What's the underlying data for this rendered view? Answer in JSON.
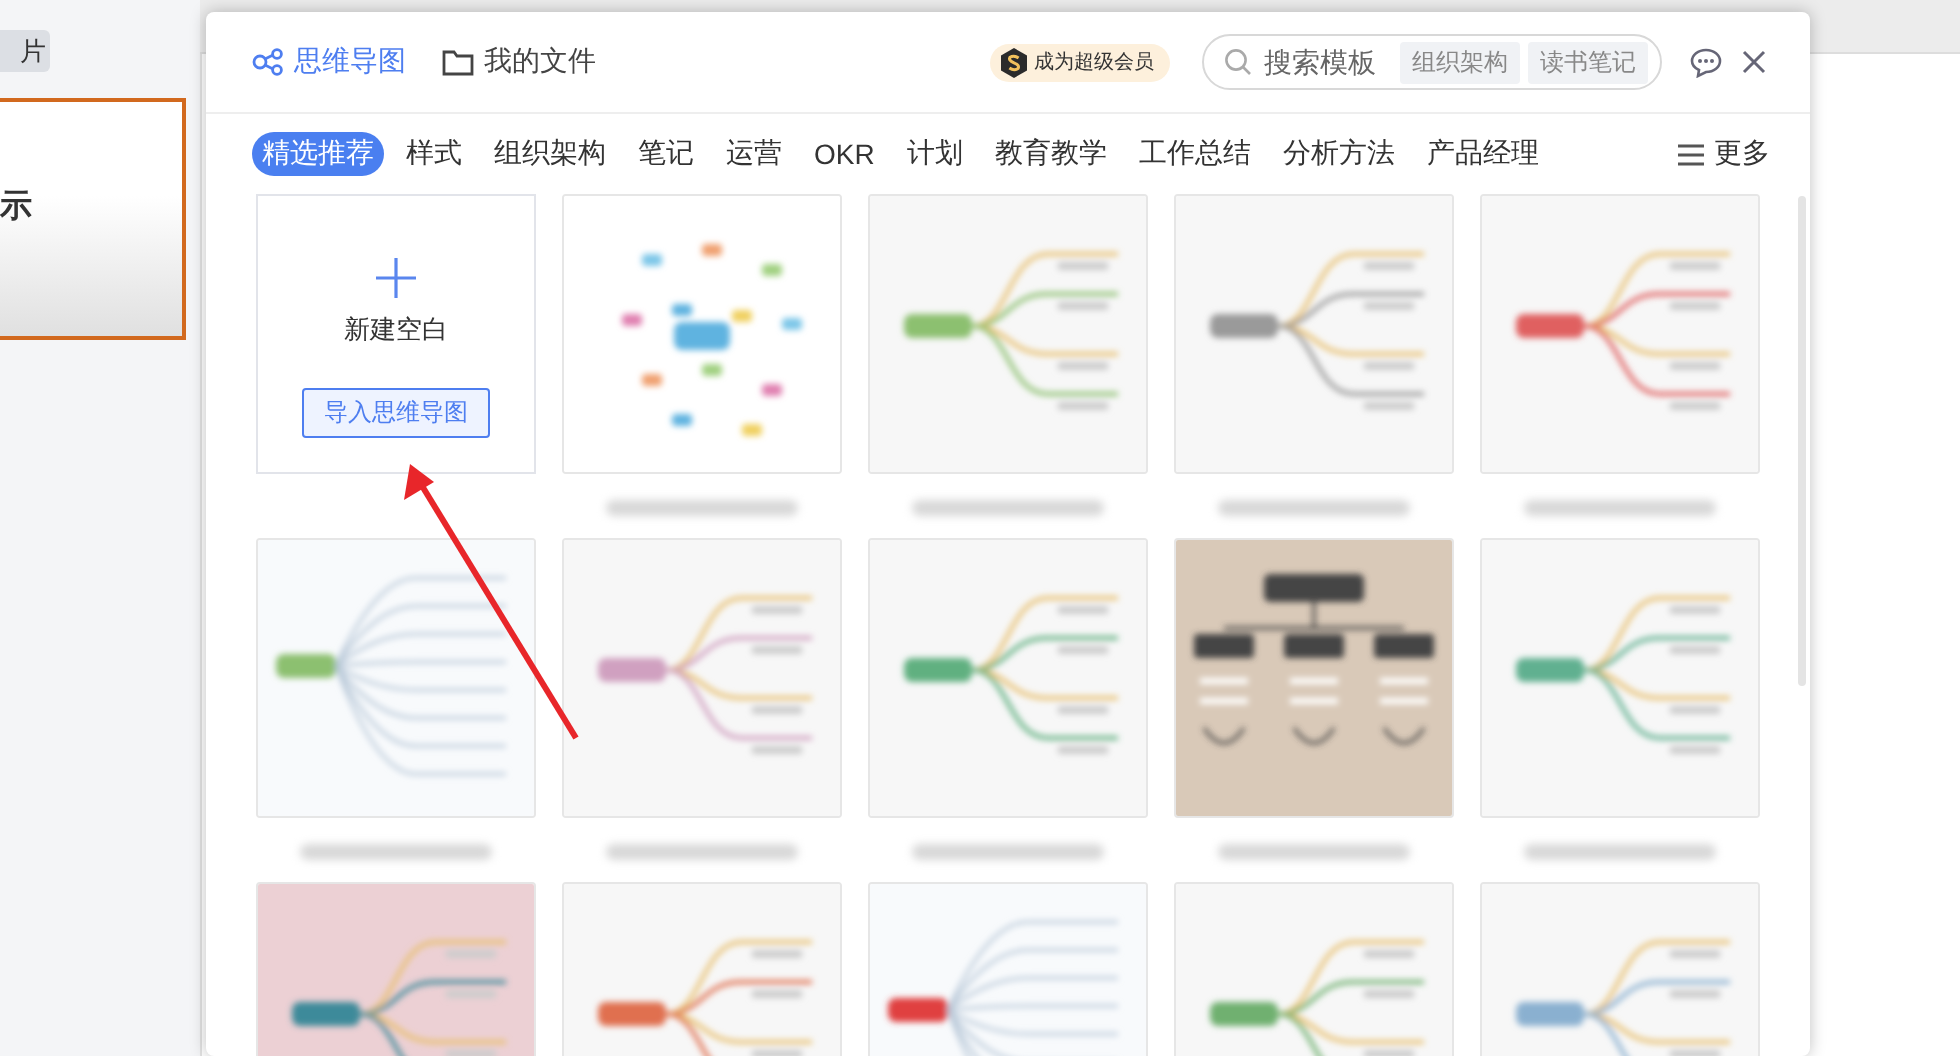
{
  "backdrop": {
    "tab_label": "片",
    "slide_title": "示"
  },
  "dialog": {
    "header_tabs": [
      {
        "label": "思维导图",
        "selected": true,
        "kind": "mindmap"
      },
      {
        "label": "我的文件",
        "selected": false,
        "kind": "folder"
      }
    ],
    "vip_badge": "成为超级会员",
    "search": {
      "placeholder": "搜索模板",
      "tags": [
        "组织架构",
        "读书笔记"
      ]
    },
    "categories": [
      {
        "label": "精选推荐",
        "selected": true
      },
      {
        "label": "样式",
        "selected": false
      },
      {
        "label": "组织架构",
        "selected": false
      },
      {
        "label": "笔记",
        "selected": false
      },
      {
        "label": "运营",
        "selected": false
      },
      {
        "label": "OKR",
        "selected": false
      },
      {
        "label": "计划",
        "selected": false
      },
      {
        "label": "教育教学",
        "selected": false
      },
      {
        "label": "工作总结",
        "selected": false
      },
      {
        "label": "分析方法",
        "selected": false
      },
      {
        "label": "产品经理",
        "selected": false
      }
    ],
    "more": "更多",
    "new_blank": {
      "label": "新建空白",
      "import_button": "导入思维导图"
    },
    "templates": [
      {
        "kind": "radial",
        "color": "#5fb3e0"
      },
      {
        "kind": "mindmap",
        "color": "#8cc070"
      },
      {
        "kind": "mindmap",
        "color": "#9a9a9a"
      },
      {
        "kind": "mindmap",
        "color": "#e06060"
      },
      {
        "kind": "tree",
        "color": "#8cc070"
      },
      {
        "kind": "mindmap",
        "color": "#d0a0c0"
      },
      {
        "kind": "mindmap",
        "color": "#60b080"
      },
      {
        "kind": "org",
        "color": "#444444"
      },
      {
        "kind": "mindmap",
        "color": "#60b090"
      },
      {
        "kind": "mindmap",
        "color": "#3d8a9a"
      },
      {
        "kind": "mindmap",
        "color": "#e07050"
      },
      {
        "kind": "tree",
        "color": "#e04040"
      },
      {
        "kind": "mindmap",
        "color": "#70b070"
      },
      {
        "kind": "mindmap",
        "color": "#8ab0d0"
      }
    ]
  }
}
